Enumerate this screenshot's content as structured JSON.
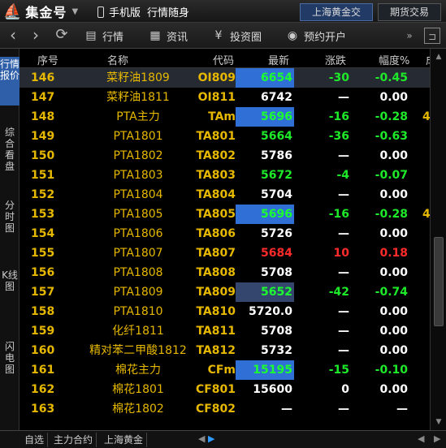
{
  "titlebar": {
    "logo": "集金号",
    "mobile_label": "手机版",
    "mobile_sub": "行情随身",
    "btn_gold": "上海黄金交易",
    "btn_futures": "期货交易"
  },
  "toolbar": {
    "market": "行情",
    "news": "资讯",
    "investment": "投资圈",
    "open_account": "预约开户"
  },
  "left_tabs": [
    "行情报价",
    "综合看盘",
    "分时图",
    "K线图",
    "闪电图"
  ],
  "columns": [
    "序号",
    "名称",
    "代码",
    "最新",
    "涨跌",
    "幅度%",
    "成"
  ],
  "rows": [
    {
      "no": "146",
      "name": "菜籽油1809",
      "code": "OI809",
      "last": "6654",
      "chg": "-30",
      "pct": "-0.45",
      "extra": "",
      "hl": "blue",
      "dir": "down",
      "sel": true
    },
    {
      "no": "147",
      "name": "菜籽油1811",
      "code": "OI811",
      "last": "6742",
      "chg": "—",
      "pct": "0.00",
      "extra": "",
      "hl": "",
      "dir": "",
      "sel": false
    },
    {
      "no": "148",
      "name": "PTA主力",
      "code": "TAm",
      "last": "5696",
      "chg": "-16",
      "pct": "-0.28",
      "extra": "4",
      "hl": "blue",
      "dir": "down",
      "sel": false
    },
    {
      "no": "149",
      "name": "PTA1801",
      "code": "TA801",
      "last": "5664",
      "chg": "-36",
      "pct": "-0.63",
      "extra": "",
      "hl": "",
      "dir": "down",
      "sel": false
    },
    {
      "no": "150",
      "name": "PTA1802",
      "code": "TA802",
      "last": "5786",
      "chg": "—",
      "pct": "0.00",
      "extra": "",
      "hl": "",
      "dir": "",
      "sel": false
    },
    {
      "no": "151",
      "name": "PTA1803",
      "code": "TA803",
      "last": "5672",
      "chg": "-4",
      "pct": "-0.07",
      "extra": "",
      "hl": "",
      "dir": "down",
      "sel": false
    },
    {
      "no": "152",
      "name": "PTA1804",
      "code": "TA804",
      "last": "5704",
      "chg": "—",
      "pct": "0.00",
      "extra": "",
      "hl": "",
      "dir": "",
      "sel": false
    },
    {
      "no": "153",
      "name": "PTA1805",
      "code": "TA805",
      "last": "5696",
      "chg": "-16",
      "pct": "-0.28",
      "extra": "4",
      "hl": "blue",
      "dir": "down",
      "sel": false
    },
    {
      "no": "154",
      "name": "PTA1806",
      "code": "TA806",
      "last": "5726",
      "chg": "—",
      "pct": "0.00",
      "extra": "",
      "hl": "",
      "dir": "",
      "sel": false
    },
    {
      "no": "155",
      "name": "PTA1807",
      "code": "TA807",
      "last": "5684",
      "chg": "10",
      "pct": "0.18",
      "extra": "",
      "hl": "",
      "dir": "up",
      "sel": false
    },
    {
      "no": "156",
      "name": "PTA1808",
      "code": "TA808",
      "last": "5708",
      "chg": "—",
      "pct": "0.00",
      "extra": "",
      "hl": "",
      "dir": "",
      "sel": false
    },
    {
      "no": "157",
      "name": "PTA1809",
      "code": "TA809",
      "last": "5652",
      "chg": "-42",
      "pct": "-0.74",
      "extra": "",
      "hl": "dark",
      "dir": "down",
      "sel": false
    },
    {
      "no": "158",
      "name": "PTA1810",
      "code": "TA810",
      "last": "5720.0",
      "chg": "—",
      "pct": "0.00",
      "extra": "",
      "hl": "",
      "dir": "",
      "sel": false
    },
    {
      "no": "159",
      "name": "化纤1811",
      "code": "TA811",
      "last": "5708",
      "chg": "—",
      "pct": "0.00",
      "extra": "",
      "hl": "",
      "dir": "",
      "sel": false
    },
    {
      "no": "160",
      "name": "精对苯二甲酸1812",
      "code": "TA812",
      "last": "5732",
      "chg": "—",
      "pct": "0.00",
      "extra": "",
      "hl": "",
      "dir": "",
      "sel": false
    },
    {
      "no": "161",
      "name": "棉花主力",
      "code": "CFm",
      "last": "15195",
      "chg": "-15",
      "pct": "-0.10",
      "extra": "",
      "hl": "blue",
      "dir": "down",
      "sel": false
    },
    {
      "no": "162",
      "name": "棉花1801",
      "code": "CF801",
      "last": "15600",
      "chg": "0",
      "pct": "0.00",
      "extra": "",
      "hl": "",
      "dir": "",
      "sel": false
    },
    {
      "no": "163",
      "name": "棉花1802",
      "code": "CF802",
      "last": "—",
      "chg": "—",
      "pct": "—",
      "extra": "",
      "hl": "",
      "dir": "",
      "sel": false
    }
  ],
  "bottom_tabs": [
    "自选",
    "主力合约",
    "上海黄金"
  ],
  "colors": {
    "accent": "#2f5fa8",
    "up": "#ff2b2b",
    "down": "#1eea2a",
    "code": "#e6b800"
  }
}
